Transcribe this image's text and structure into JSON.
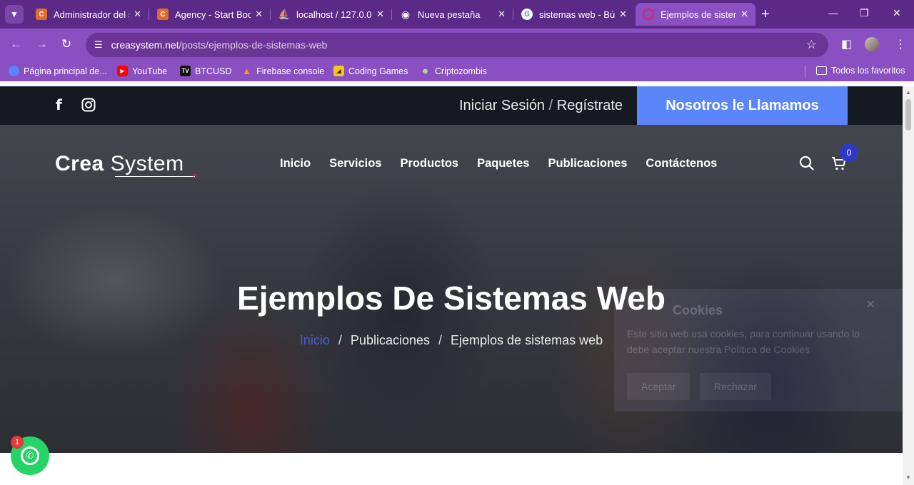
{
  "browser": {
    "tabs": [
      {
        "label": "Administrador del s",
        "favicon_color": "#e06c2c",
        "favicon_glyph": "C"
      },
      {
        "label": "Agency - Start Boo",
        "favicon_color": "#e06c2c",
        "favicon_glyph": "C"
      },
      {
        "label": "localhost / 127.0.0.",
        "favicon_color": "#f0a020",
        "favicon_glyph": "⛵"
      },
      {
        "label": "Nueva pestaña",
        "favicon_color": "#ffffff",
        "favicon_glyph": "◉"
      },
      {
        "label": "sistemas web - Bús",
        "favicon_color": "#ffffff",
        "favicon_glyph": "G"
      },
      {
        "label": "Ejemplos de sistem",
        "favicon_color": "#e0245e",
        "favicon_glyph": "○"
      }
    ],
    "url_domain": "creasystem.net",
    "url_path": "/posts/ejemplos-de-sistemas-web",
    "bookmarks": [
      {
        "label": "Página principal de...",
        "icon_color": "#5b86f9"
      },
      {
        "label": "YouTube",
        "icon_color": "#ff0000"
      },
      {
        "label": "BTCUSD",
        "icon_color": "#111111"
      },
      {
        "label": "Firebase console",
        "icon_color": "#ffa000"
      },
      {
        "label": "Coding Games",
        "icon_color": "#f5c518"
      },
      {
        "label": "Criptozombis",
        "icon_color": "#6b8e23"
      }
    ],
    "all_bookmarks_label": "Todos los favoritos"
  },
  "site": {
    "topbar": {
      "login_label": "Iniciar Sesión",
      "separator": "/",
      "register_label": "Regístrate",
      "call_button": "Nosotros le Llamamos"
    },
    "logo": {
      "bold": "Crea",
      "light": "System"
    },
    "nav": [
      "Inicio",
      "Servicios",
      "Productos",
      "Paquetes",
      "Publicaciones",
      "Contáctenos"
    ],
    "cart_count": "0",
    "hero_title": "Ejemplos De Sistemas Web",
    "breadcrumb": {
      "home": "Inicio",
      "sep": "/",
      "section": "Publicaciones",
      "current": "Ejemplos de sistemas web"
    },
    "cookie": {
      "title": "Cookies",
      "text": "Este sitio web usa cookies, para continuar usando lo debe aceptar nuestra Política de Cookies",
      "accept": "Aceptar",
      "reject": "Rechazar"
    },
    "whatsapp_badge": "1"
  },
  "colors": {
    "browser_purple": "#8a4fc0",
    "topbar": "#151a22",
    "call_button": "#5b86f9",
    "whatsapp": "#25d366"
  }
}
